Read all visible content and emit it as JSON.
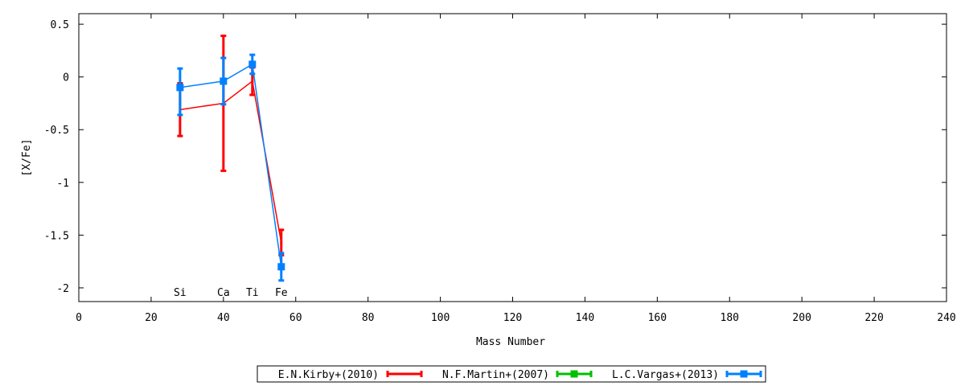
{
  "chart_data": {
    "type": "line",
    "title": "",
    "xlabel": "Mass Number",
    "ylabel": "[X/Fe]",
    "xlim": [
      0,
      240
    ],
    "ylim": [
      -2.13,
      0.6
    ],
    "xticks": [
      0,
      20,
      40,
      60,
      80,
      100,
      120,
      140,
      160,
      180,
      200,
      220,
      240
    ],
    "yticks": [
      0.5,
      0,
      -0.5,
      -1,
      -1.5,
      -2
    ],
    "ytick_labels": [
      "0.5",
      "0",
      "-0.5",
      "-1",
      "-1.5",
      "-2"
    ],
    "grid": false,
    "legend_position": "bottom-center",
    "element_labels": [
      {
        "text": "Si",
        "x": 28
      },
      {
        "text": "Ca",
        "x": 40
      },
      {
        "text": "Ti",
        "x": 48
      },
      {
        "text": "Fe",
        "x": 56
      }
    ],
    "series": [
      {
        "name": "E.N.Kirby+(2010)",
        "color": "#ff0000",
        "marker": "none",
        "points": [
          {
            "x": 28,
            "y": -0.31,
            "err_low": 0.25,
            "err_high": 0.25
          },
          {
            "x": 40,
            "y": -0.25,
            "err_low": 0.64,
            "err_high": 0.64
          },
          {
            "x": 48,
            "y": -0.04,
            "err_low": 0.13,
            "err_high": 0.13
          },
          {
            "x": 56,
            "y": -1.57,
            "err_low": 0.12,
            "err_high": 0.12
          }
        ]
      },
      {
        "name": "N.F.Martin+(2007)",
        "color": "#00c000",
        "marker": "square",
        "points": []
      },
      {
        "name": "L.C.Vargas+(2013)",
        "color": "#0080ff",
        "marker": "square",
        "points": [
          {
            "x": 28,
            "y": -0.1,
            "err_low": 0.26,
            "err_high": 0.18
          },
          {
            "x": 40,
            "y": -0.04,
            "err_low": 0.22,
            "err_high": 0.22
          },
          {
            "x": 48,
            "y": 0.12,
            "err_low": 0.09,
            "err_high": 0.09
          },
          {
            "x": 56,
            "y": -1.8,
            "err_low": 0.13,
            "err_high": 0.13
          }
        ]
      }
    ]
  }
}
